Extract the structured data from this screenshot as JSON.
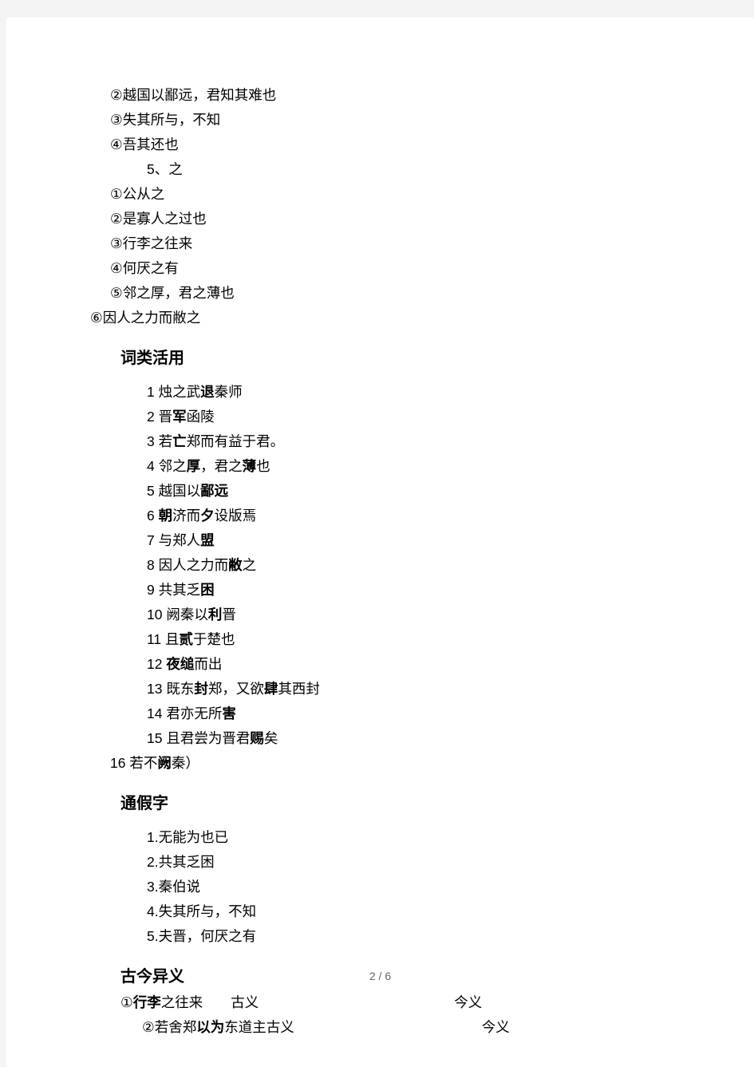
{
  "page": {
    "footer": "2 / 6"
  },
  "particle_block": {
    "items_before": [
      "②越国以鄙远，君知其难也",
      "③失其所与，不知",
      "④吾其还也"
    ],
    "subheading": "5、之",
    "items": [
      "①公从之",
      "②是寡人之过也",
      "③行李之往来",
      "④何厌之有",
      "⑤邻之厚，君之薄也"
    ],
    "item_last": "⑥因人之力而敝之"
  },
  "sections": [
    {
      "heading": "词类活用",
      "items": [
        {
          "num": "1",
          "pre": "烛之武",
          "bold": "退",
          "post": "秦师"
        },
        {
          "num": "2",
          "pre": "晋",
          "bold": "军",
          "post": "函陵"
        },
        {
          "num": "3",
          "pre": "若",
          "bold": "亡",
          "post": "郑而有益于君。"
        },
        {
          "num": "4",
          "pre": "邻之",
          "bold": "厚",
          "post": "，君之",
          "bold2": "薄",
          "post2": "也"
        },
        {
          "num": "5",
          "pre": "越国以",
          "bold": "鄙远",
          "post": ""
        },
        {
          "num": "6",
          "pre": "",
          "bold": "朝",
          "post": "济而",
          "bold2": "夕",
          "post2": "设版焉"
        },
        {
          "num": "7",
          "pre": "与郑人",
          "bold": "盟",
          "post": ""
        },
        {
          "num": "8",
          "pre": "因人之力而",
          "bold": "敝",
          "post": "之"
        },
        {
          "num": "9",
          "pre": "共其乏",
          "bold": "困",
          "post": ""
        },
        {
          "num": "10",
          "pre": "阙秦以",
          "bold": "利",
          "post": "晋"
        },
        {
          "num": "11",
          "pre": "且",
          "bold": "贰",
          "post": "于楚也"
        },
        {
          "num": "12",
          "pre": "",
          "bold": "夜缒",
          "post": "而出"
        },
        {
          "num": "13",
          "pre": "既东",
          "bold": "封",
          "post": "郑，又欲",
          "bold2": "肆",
          "post2": "其西封"
        },
        {
          "num": "14",
          "pre": "君亦无所",
          "bold": "害",
          "post": ""
        },
        {
          "num": "15",
          "pre": "且君尝为晋君",
          "bold": "赐",
          "post": "矣"
        },
        {
          "num": "16",
          "pre": "若不",
          "bold": "阙",
          "post": "秦）"
        }
      ]
    },
    {
      "heading": "通假字",
      "items": [
        "1.无能为也已",
        "2.共其乏困",
        "3.秦伯说",
        "4.失其所与，不知",
        "5.夫晋，何厌之有"
      ]
    },
    {
      "heading": "古今异义",
      "rows": [
        {
          "marker": "①",
          "bold": "行李",
          "rest": "之往来",
          "old_label": "古义",
          "new_label": "今义"
        },
        {
          "marker": "②",
          "pre": "若舍郑",
          "bold": "以为",
          "rest": "东道主古义",
          "new_label": "今义"
        }
      ]
    }
  ]
}
